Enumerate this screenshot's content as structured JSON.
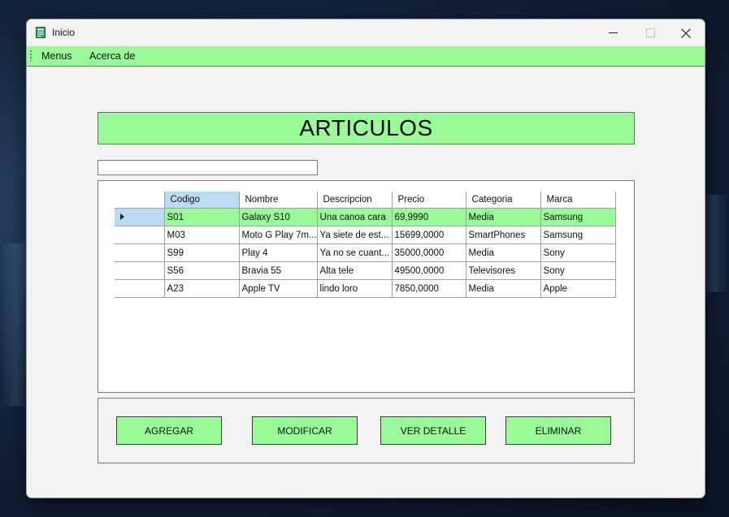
{
  "window": {
    "title": "Inicio"
  },
  "menu": {
    "items": [
      "Menus",
      "Acerca de"
    ]
  },
  "heading": "ARTICULOS",
  "search": {
    "value": ""
  },
  "grid": {
    "columns": [
      "Codigo",
      "Nombre",
      "Descripcion",
      "Precio",
      "Categoria",
      "Marca"
    ],
    "rows": [
      [
        "S01",
        "Galaxy S10",
        "Una canoa cara",
        "69,9990",
        "Media",
        "Samsung"
      ],
      [
        "M03",
        "Moto G Play 7m...",
        "Ya siete de est...",
        "15699,0000",
        "SmartPhones",
        "Samsung"
      ],
      [
        "S99",
        "Play 4",
        "Ya no se cuant...",
        "35000,0000",
        "Media",
        "Sony"
      ],
      [
        "S56",
        "Bravia 55",
        "Alta tele",
        "49500,0000",
        "Televisores",
        "Sony"
      ],
      [
        "A23",
        "Apple TV",
        "lindo loro",
        "7850,0000",
        "Media",
        "Apple"
      ]
    ],
    "selected_row": 0
  },
  "buttons": {
    "agregar": "AGREGAR",
    "modificar": "MODIFICAR",
    "ver_detalle": "VER DETALLE",
    "eliminar": "ELIMINAR"
  },
  "colors": {
    "accent_green": "#98fb98",
    "selection_blue": "#bcdcf4"
  },
  "icons": [
    "app-icon",
    "minimize-icon",
    "maximize-icon",
    "close-icon",
    "menu-grip-icon",
    "row-selector-arrow-icon"
  ]
}
